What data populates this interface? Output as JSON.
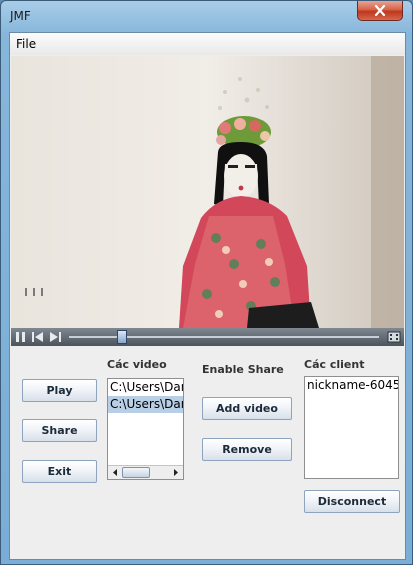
{
  "window": {
    "title": "JMF"
  },
  "menu": {
    "file": "File"
  },
  "player": {
    "position": 0.17
  },
  "buttons": {
    "play": "Play",
    "share": "Share",
    "exit": "Exit",
    "add_video": "Add video",
    "remove": "Remove",
    "disconnect": "Disconnect"
  },
  "labels": {
    "videos": "Các video",
    "enable_share": "Enable Share",
    "clients": "Các client"
  },
  "videos": [
    {
      "path": "C:\\Users\\Dan"
    },
    {
      "path": "C:\\Users\\Dan"
    }
  ],
  "clients": [
    {
      "name": "nickname-6045"
    }
  ],
  "colors": {
    "selection": "#b8cfe5",
    "close_button": "#c9432a"
  }
}
